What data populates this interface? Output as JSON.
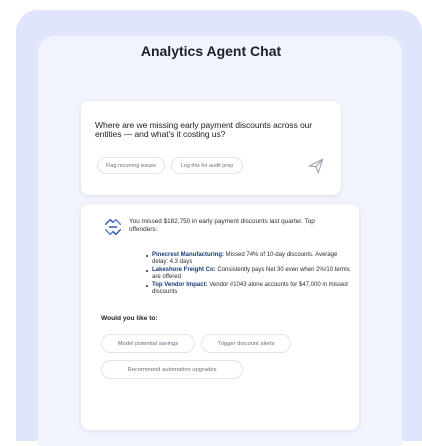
{
  "header": {
    "title": "Analytics Agent Chat"
  },
  "query": {
    "text": "Where are we missing early payment discounts across our entities — and what's it costing us?",
    "chips": [
      "Flag recurring issues",
      "Log this for audit prep"
    ],
    "send_icon": "send-icon"
  },
  "answer": {
    "agent_icon": "agent-logo-icon",
    "intro": "You missed $182,750 in early payment discounts last quarter. Top offenders:",
    "bullets": [
      {
        "lead": "Pinecrest Manufacturing:",
        "text": " Missed 74% of 10-day discounts. Average delay: 4.3 days"
      },
      {
        "lead": "Lakeshore Freight Co:",
        "text": " Consistently pays Net 30 even when 2%/10 terms are offered"
      },
      {
        "lead": "Top Vendor Impact:",
        "text": " Vendor #1043 alone accounts for $47,000 in missed discounts"
      }
    ],
    "prompt": "Would you like to:",
    "options": [
      "Model potential savings",
      "Trigger discount alerts",
      "Recommend automation upgrades"
    ]
  },
  "colors": {
    "outer_bg": "#dfe6fb",
    "panel_bg": "#f1f4fd",
    "card_bg": "#ffffff",
    "accent": "#1b3a7a"
  }
}
